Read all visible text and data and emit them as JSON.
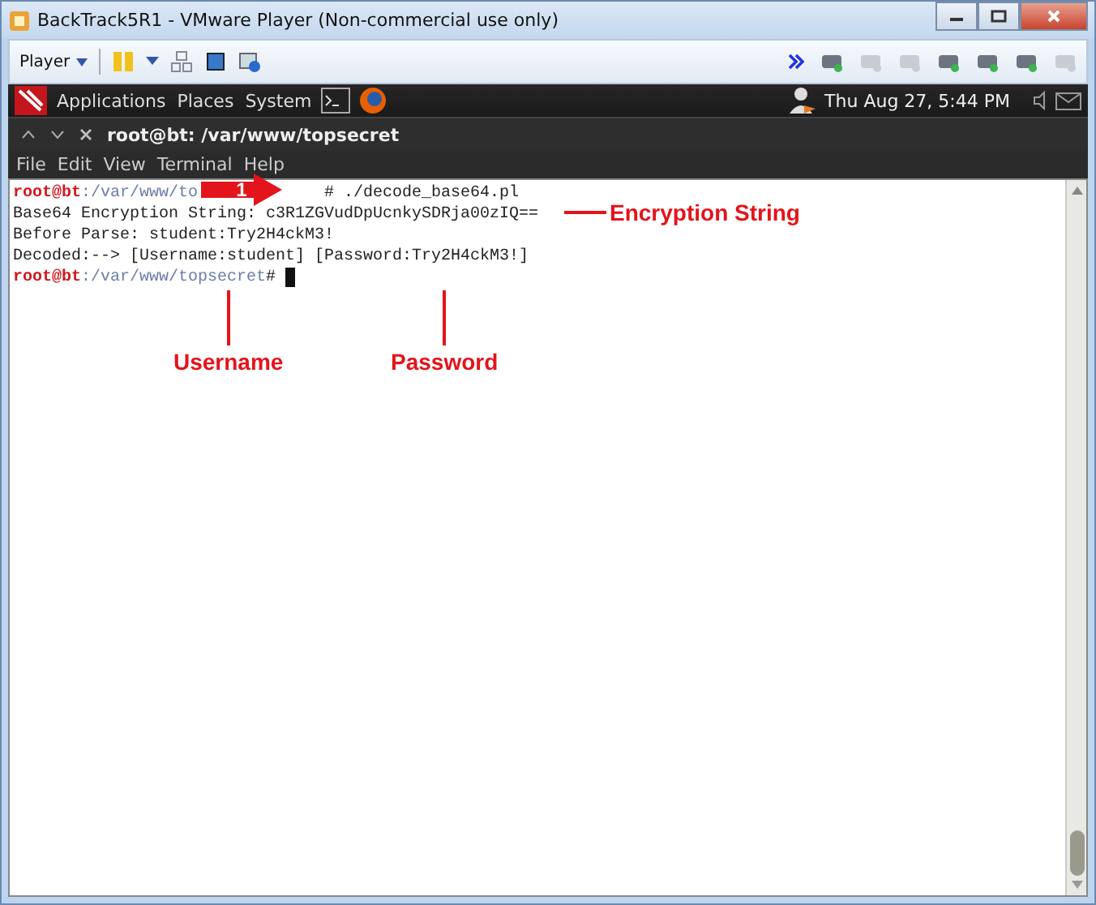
{
  "window": {
    "title": "BackTrack5R1 - VMware Player (Non-commercial use only)"
  },
  "toolbar": {
    "player_label": "Player"
  },
  "panel": {
    "menus": [
      "Applications",
      "Places",
      "System"
    ],
    "clock": "Thu Aug 27,  5:44 PM"
  },
  "terminal": {
    "title": "root@bt: /var/www/topsecret",
    "menu": [
      "File",
      "Edit",
      "View",
      "Terminal",
      "Help"
    ],
    "lines": [
      {
        "segments": [
          {
            "kind": "user",
            "text": "root@bt"
          },
          {
            "kind": "path",
            "text": ":/var/www/to"
          },
          {
            "kind": "after-arrow",
            "text": "# ./decode_base64.pl"
          }
        ],
        "cursor": false
      },
      {
        "segments": [
          {
            "kind": "plain",
            "text": "Base64 Encryption String: c3R1ZGVudDpUcnkySDRja00zIQ=="
          }
        ],
        "cursor": false
      },
      {
        "segments": [
          {
            "kind": "plain",
            "text": "Before Parse: student:Try2H4ckM3!"
          }
        ],
        "cursor": false
      },
      {
        "segments": [
          {
            "kind": "plain",
            "text": "Decoded:--> [Username:student] [Password:Try2H4ckM3!]"
          }
        ],
        "cursor": false
      },
      {
        "segments": [
          {
            "kind": "user",
            "text": "root@bt"
          },
          {
            "kind": "path",
            "text": ":/var/www/topsecret"
          },
          {
            "kind": "plain",
            "text": "# "
          }
        ],
        "cursor": true
      }
    ]
  },
  "annotations": {
    "step": "1",
    "labels": [
      {
        "kind": "side",
        "text": "Encryption String"
      },
      {
        "kind": "below",
        "text": "Username"
      },
      {
        "kind": "below",
        "text": "Password"
      }
    ]
  }
}
